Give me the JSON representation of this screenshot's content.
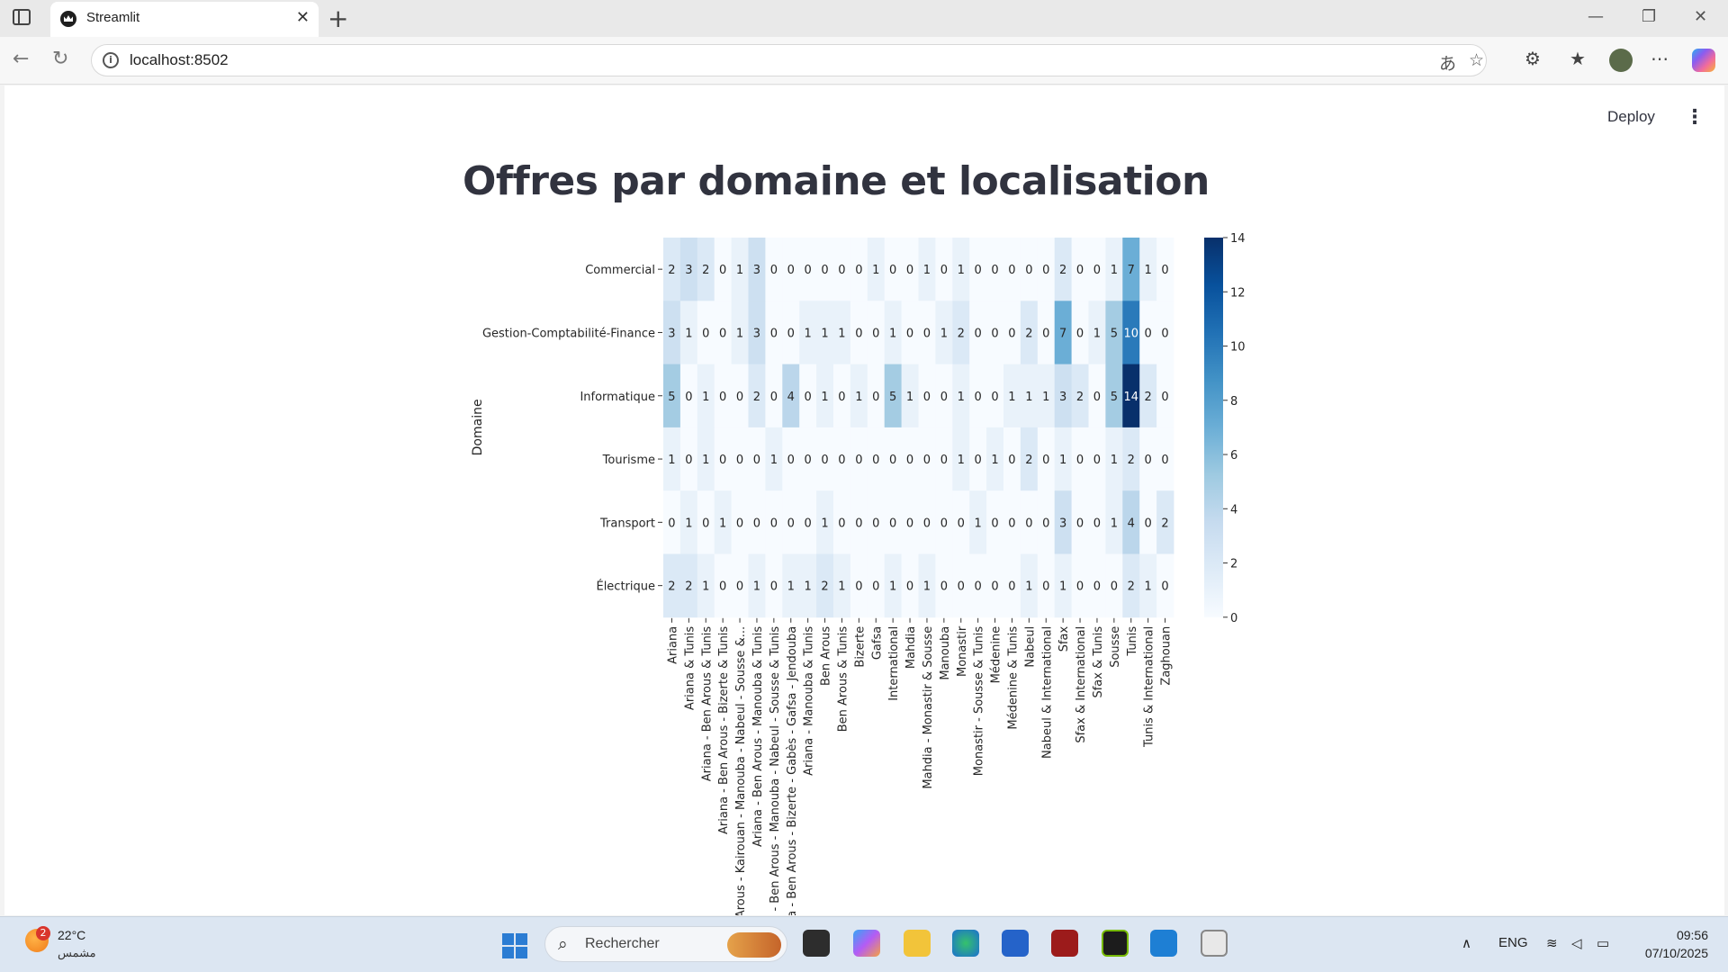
{
  "browser": {
    "tab_title": "Streamlit",
    "url": "localhost:8502"
  },
  "app": {
    "deploy_label": "Deploy",
    "menu_icon": "kebab-icon",
    "title": "Offres par domaine et localisation"
  },
  "chart_data": {
    "type": "heatmap",
    "title": "",
    "ylabel": "Domaine",
    "xlabel": "",
    "colormap": "Blues",
    "color_range": [
      0,
      14
    ],
    "colorbar_ticks": [
      0,
      2,
      4,
      6,
      8,
      10,
      12,
      14
    ],
    "rows": [
      "Commercial",
      "Gestion-Comptabilité-Finance",
      "Informatique",
      "Tourisme",
      "Transport",
      "Électrique"
    ],
    "columns": [
      "Ariana",
      "Ariana & Tunis",
      "Ariana - Ben Arous & Tunis",
      "Ariana - Ben Arous - Bizerte & Tunis",
      "Arous - Kairouan - Manouba - Nabeul - Sousse &...",
      "Ariana - Ben Arous - Manouba & Tunis",
      "a - Ben Arous - Manouba - Nabeul - Sousse & Tunis",
      "ja - Ben Arous - Bizerte - Gabès - Gafsa - Jendouba",
      "Ariana - Manouba & Tunis",
      "Ben Arous",
      "Ben Arous & Tunis",
      "Bizerte",
      "Gafsa",
      "International",
      "Mahdia",
      "Mahdia - Monastir & Sousse",
      "Manouba",
      "Monastir",
      "Monastir - Sousse & Tunis",
      "Médenine",
      "Médenine & Tunis",
      "Nabeul",
      "Nabeul & International",
      "Sfax",
      "Sfax & International",
      "Sfax & Tunis",
      "Sousse",
      "Tunis",
      "Tunis & International",
      "Zaghouan"
    ],
    "values": [
      [
        2,
        3,
        2,
        0,
        1,
        3,
        0,
        0,
        0,
        0,
        0,
        0,
        1,
        0,
        0,
        1,
        0,
        1,
        0,
        0,
        0,
        0,
        0,
        2,
        0,
        0,
        1,
        7,
        1,
        0
      ],
      [
        3,
        1,
        0,
        0,
        1,
        3,
        0,
        0,
        1,
        1,
        1,
        0,
        0,
        1,
        0,
        0,
        1,
        2,
        0,
        0,
        0,
        2,
        0,
        7,
        0,
        1,
        5,
        10,
        0,
        0
      ],
      [
        5,
        0,
        1,
        0,
        0,
        2,
        0,
        4,
        0,
        1,
        0,
        1,
        0,
        5,
        1,
        0,
        0,
        1,
        0,
        0,
        1,
        1,
        1,
        3,
        2,
        0,
        5,
        14,
        2,
        0
      ],
      [
        1,
        0,
        1,
        0,
        0,
        0,
        1,
        0,
        0,
        0,
        0,
        0,
        0,
        0,
        0,
        0,
        0,
        1,
        0,
        1,
        0,
        2,
        0,
        1,
        0,
        0,
        1,
        2,
        0,
        0
      ],
      [
        0,
        1,
        0,
        1,
        0,
        0,
        0,
        0,
        0,
        1,
        0,
        0,
        0,
        0,
        0,
        0,
        0,
        0,
        1,
        0,
        0,
        0,
        0,
        3,
        0,
        0,
        1,
        4,
        0,
        2
      ],
      [
        2,
        2,
        1,
        0,
        0,
        1,
        0,
        1,
        1,
        2,
        1,
        0,
        0,
        1,
        0,
        1,
        0,
        0,
        0,
        0,
        0,
        1,
        0,
        1,
        0,
        0,
        0,
        2,
        1,
        0
      ]
    ]
  },
  "taskbar": {
    "weather_temp": "22°C",
    "weather_desc": "مشمس",
    "weather_badge": "2",
    "search_placeholder": "Rechercher",
    "lang": "ENG",
    "time": "09:56",
    "date": "07/10/2025"
  }
}
